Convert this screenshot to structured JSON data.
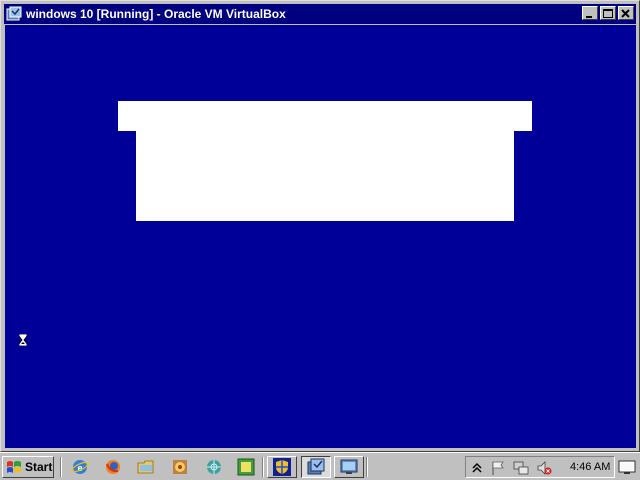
{
  "window": {
    "title": "windows 10 [Running] - Oracle VM VirtualBox",
    "icon": "virtualbox-icon",
    "controls": [
      "minimize-icon",
      "maximize-icon",
      "close-icon"
    ]
  },
  "vm_screen": {
    "background": "#000099",
    "cursor": "hourglass-icon"
  },
  "taskbar": {
    "start_label": "Start",
    "quick_launch": [
      "internet-explorer-icon",
      "firefox-icon",
      "folder-icon",
      "media-icon",
      "network-icon",
      "app-icon"
    ],
    "tasks": [
      {
        "icon": "shield-icon",
        "active": false
      },
      {
        "icon": "virtualbox-icon",
        "active": true
      },
      {
        "icon": "remote-desktop-icon",
        "active": false
      }
    ],
    "tray": [
      "chevron-up-icon",
      "flag-icon",
      "network-icon",
      "volume-muted-icon"
    ],
    "clock": "4:46 AM"
  }
}
